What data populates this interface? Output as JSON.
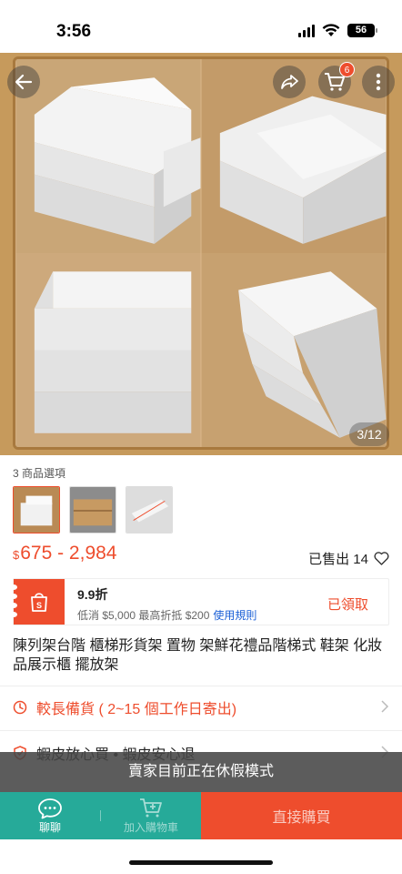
{
  "status_bar": {
    "time": "3:56",
    "battery": "56"
  },
  "hero": {
    "cart_count": "6",
    "page_counter": "3/12"
  },
  "options": {
    "label": "3 商品選項"
  },
  "price": {
    "currency": "$",
    "range": "675 - 2,984",
    "sold": "已售出 14"
  },
  "voucher": {
    "title": "9.9折",
    "detail": "低消 $5,000 最高折抵 $200",
    "rule_link": "使用規則",
    "status": "已領取"
  },
  "product": {
    "title": "陳列架台階 櫃梯形貨架 置物 架鮮花禮品階梯式 鞋架 化妝品展示櫃 擺放架"
  },
  "shipping": {
    "text": "較長備貨 ( 2~15 個工作日寄出)"
  },
  "guarantee": {
    "text": "蝦皮放心買 • 蝦皮安心退"
  },
  "vacation": {
    "text": "賣家目前正在休假模式"
  },
  "bottom_bar": {
    "chat": "聊聊",
    "add_to_cart": "加入購物車",
    "buy_now": "直接購買"
  },
  "colors": {
    "accent": "#ee4d2d",
    "teal": "#26aa99",
    "link": "#1a5fd6"
  }
}
